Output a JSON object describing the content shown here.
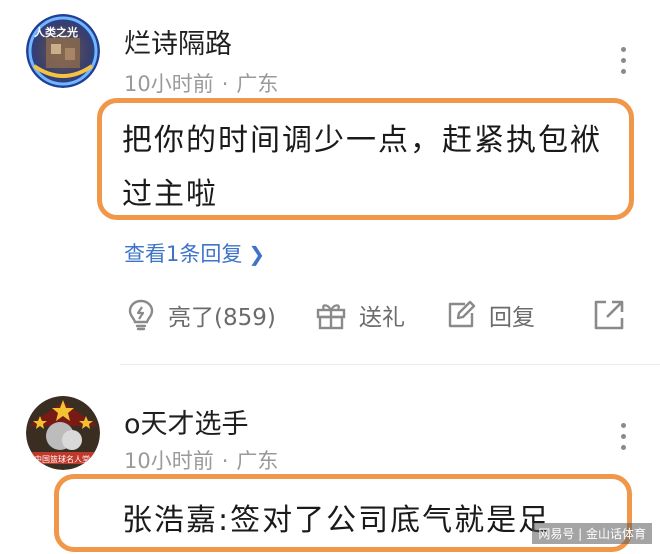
{
  "comments": [
    {
      "username": "烂诗隔路",
      "time": "10小时前",
      "separator": "·",
      "location": "广东",
      "text_lines": [
        "把你的时间调少一点，赶紧执包袱",
        "过主啦"
      ],
      "view_replies": "查看1条回复",
      "actions": {
        "like": "亮了(859)",
        "gift": "送礼",
        "reply": "回复"
      },
      "avatar_text": "人类之光"
    },
    {
      "username": "o天才选手",
      "time": "10小时前",
      "separator": "·",
      "location": "广东",
      "text_lines": [
        "张浩嘉:签对了公司底气就是足"
      ],
      "avatar_text": "中国篮球名人堂"
    }
  ],
  "watermark": "网易号 | 金山话体育",
  "colors": {
    "highlight_border": "#f0974a",
    "link": "#3d74c9",
    "meta": "#9a9a9a"
  }
}
